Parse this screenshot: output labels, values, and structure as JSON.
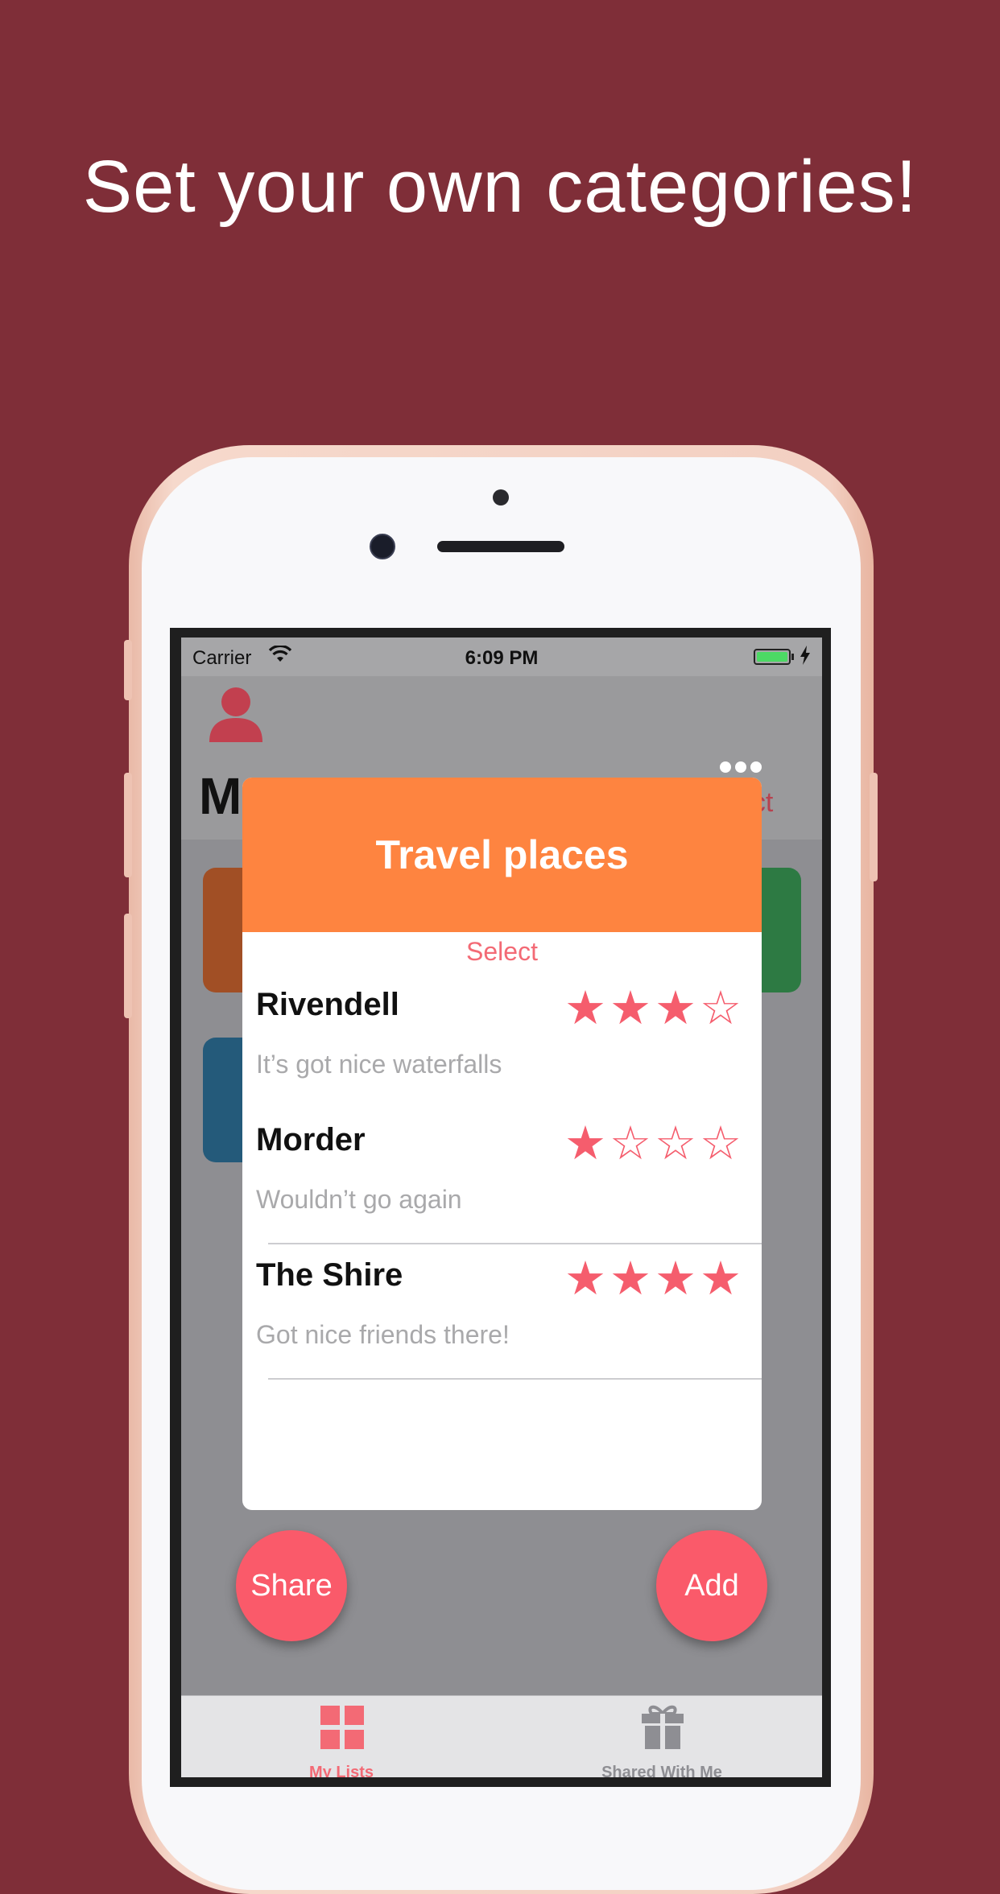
{
  "headline": "Set your own categories!",
  "status_bar": {
    "carrier": "Carrier",
    "time": "6:09 PM"
  },
  "background_screen": {
    "title_peek": "M",
    "select_peek": "ect",
    "cards": [
      {
        "color": "#a14f25"
      },
      {
        "color": "#2d7a43"
      },
      {
        "color": "#245a7a"
      }
    ]
  },
  "modal": {
    "title": "Travel places",
    "header_color": "#fe8440",
    "select_label": "Select",
    "items": [
      {
        "name": "Rivendell",
        "note": "It’s got nice waterfalls",
        "rating": 3,
        "stars": "★★★☆"
      },
      {
        "name": "Morder",
        "note": "Wouldn’t go again",
        "rating": 1,
        "stars": "★☆☆☆"
      },
      {
        "name": "The Shire",
        "note": "Got nice friends there!",
        "rating": 4,
        "stars": "★★★★"
      }
    ]
  },
  "buttons": {
    "share": "Share",
    "add": "Add"
  },
  "tabbar": {
    "tabs": [
      {
        "label": "My Lists",
        "icon": "grid-icon",
        "active": true
      },
      {
        "label": "Shared With Me",
        "icon": "gift-icon",
        "active": false
      }
    ]
  },
  "colors": {
    "background": "#7f2e38",
    "accent": "#fa5a6a",
    "star": "#f55d6d"
  }
}
